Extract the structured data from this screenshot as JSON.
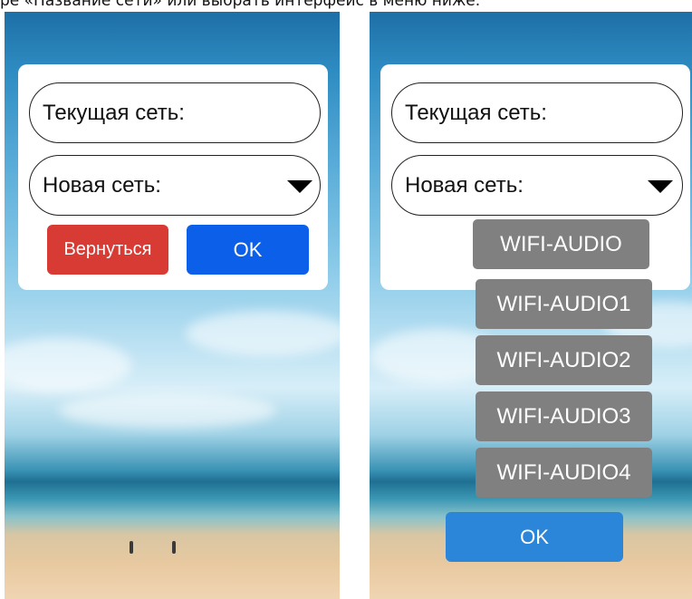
{
  "caption": "ре «Название сети» или выбрать интерфейс в меню ниже.",
  "left_screen": {
    "current_network_label": "Текущая сеть:",
    "new_network_label": "Новая сеть:",
    "back_button": "Вернуться",
    "ok_button": "OK"
  },
  "right_screen": {
    "current_network_label": "Текущая сеть:",
    "new_network_label": "Новая сеть:",
    "network_options": [
      "WIFI-AUDIO",
      "WIFI-AUDIO1",
      "WIFI-AUDIO2",
      "WIFI-AUDIO3",
      "WIFI-AUDIO4"
    ],
    "ok_button": "OK"
  },
  "colors": {
    "back_button": "#d83a34",
    "ok_button_left": "#0c5fe8",
    "ok_button_right": "#2b86da",
    "dropdown_item": "#808080"
  }
}
